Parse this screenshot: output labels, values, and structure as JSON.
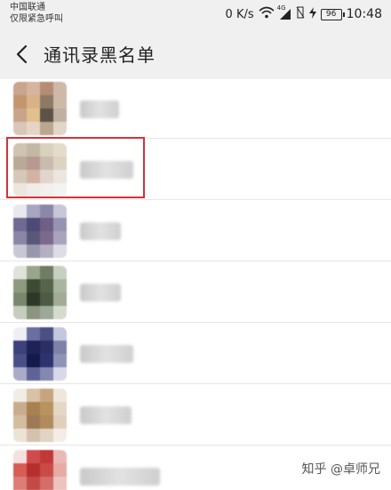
{
  "status_bar": {
    "carrier_line1": "中国联通",
    "carrier_line2": "仅限紧急呼叫",
    "net_speed": "0 K/s",
    "network_type": "4G",
    "battery": "96",
    "time": "10:48",
    "icons": [
      "wifi-icon",
      "signal-icon",
      "no-sim-icon",
      "charging-icon"
    ]
  },
  "header": {
    "title": "通讯录黑名单",
    "back_icon": "chevron-left-icon"
  },
  "contacts": [
    {
      "avatar_colors": [
        "#c9a58e",
        "#d6b49e",
        "#b58d74",
        "#d0b8a8",
        "#c3966f",
        "#d9b387",
        "#8c7966",
        "#cdb9a8",
        "#c7a48a",
        "#e2c08c",
        "#5c5247",
        "#bfb0a2",
        "#d8c6b8",
        "#e6d5c6",
        "#bba68f",
        "#e3d6c8"
      ]
    },
    {
      "avatar_colors": [
        "#cfc4b2",
        "#c2b8a5",
        "#d9d0bd",
        "#e3dccb",
        "#b9aa98",
        "#b79a8f",
        "#c8bcae",
        "#dcd3c0",
        "#d6c7bb",
        "#d4b3a6",
        "#e1d5cc",
        "#ebe6e0",
        "#ede6df",
        "#f0ece8",
        "#f2efec",
        "#f5f3f1"
      ]
    },
    {
      "avatar_colors": [
        "#e8e8ef",
        "#a7a5bf",
        "#8b87a8",
        "#c8c6d8",
        "#6e6a92",
        "#4c4a76",
        "#6f5f86",
        "#9793b2",
        "#8a86a6",
        "#5b5777",
        "#7c6a8c",
        "#a9a3bd",
        "#c9c7d6",
        "#9997ad",
        "#b3b0c4",
        "#dedde6"
      ]
    },
    {
      "avatar_colors": [
        "#dfe3da",
        "#9aa58c",
        "#6f7d62",
        "#c7cfc0",
        "#8e9a80",
        "#3f4a35",
        "#56644a",
        "#aab59f",
        "#7b876d",
        "#2e3828",
        "#4e5a44",
        "#a1ab95",
        "#c6ccbe",
        "#8a947e",
        "#9ea896",
        "#d6dbd0"
      ]
    },
    {
      "avatar_colors": [
        "#eeeef5",
        "#6a6fa0",
        "#4a4f84",
        "#c4c6dc",
        "#3d427a",
        "#1e2256",
        "#2a2f66",
        "#7e81a8",
        "#4b4f87",
        "#151a4a",
        "#2e3370",
        "#8f93b6",
        "#a9abc8",
        "#5f6398",
        "#8488b0",
        "#d8d9e8"
      ]
    },
    {
      "avatar_colors": [
        "#f1ece6",
        "#d8c1a4",
        "#c8a47e",
        "#efe6dc",
        "#c9ac8e",
        "#a8814f",
        "#b8935f",
        "#e5d7c6",
        "#d4bca1",
        "#9c7a55",
        "#b18a5e",
        "#e0cfbb",
        "#ece3d8",
        "#d5c2ad",
        "#e2d4c4",
        "#f3ede6"
      ]
    },
    {
      "avatar_colors": [
        "#f3e1e0",
        "#d04c4c",
        "#c13838",
        "#eab9b6",
        "#d65c56",
        "#b72e2e",
        "#c94b47",
        "#e7aaa5",
        "#dd7d78",
        "#c44a46",
        "#d46c67",
        "#ecc3bf",
        "#efd2cf",
        "#e5a7a2",
        "#ebbdb9",
        "#f5e2e0"
      ]
    }
  ],
  "watermark": "知乎 @卓师兄"
}
